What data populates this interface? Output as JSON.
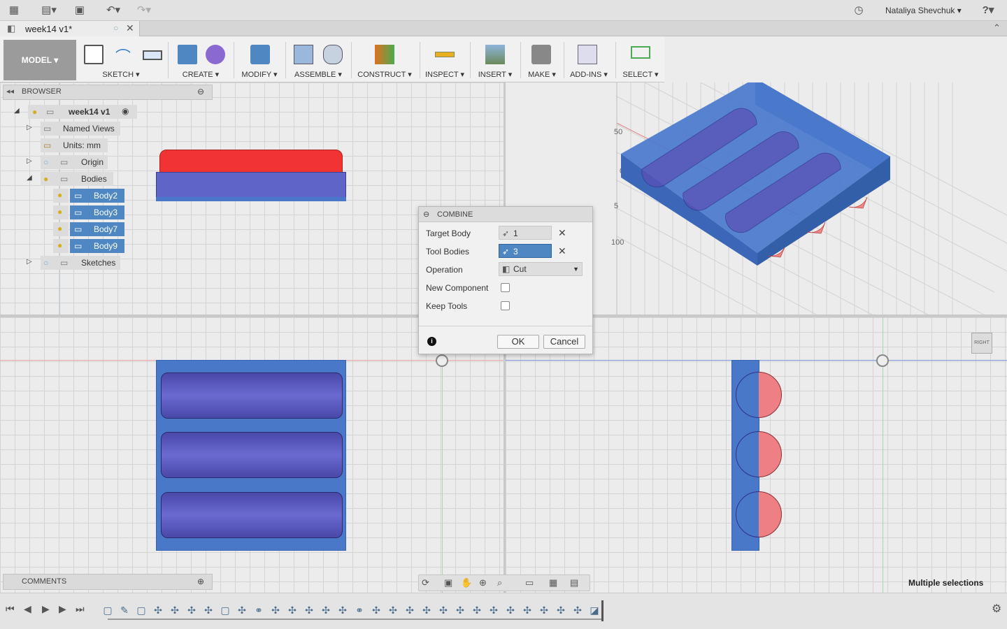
{
  "app": {
    "doc_tab_title": "week14 v1*",
    "user_name": "Nataliya Shevchuk",
    "user_caret": "▾",
    "help_icon": "?"
  },
  "toolbar": {
    "mode": "MODEL",
    "groups": [
      {
        "label": "SKETCH"
      },
      {
        "label": "CREATE"
      },
      {
        "label": "MODIFY"
      },
      {
        "label": "ASSEMBLE"
      },
      {
        "label": "CONSTRUCT"
      },
      {
        "label": "INSPECT"
      },
      {
        "label": "INSERT"
      },
      {
        "label": "MAKE"
      },
      {
        "label": "ADD-INS"
      },
      {
        "label": "SELECT"
      }
    ]
  },
  "browser": {
    "title": "BROWSER",
    "root": "week14 v1",
    "items": [
      {
        "label": "Named Views"
      },
      {
        "label": "Units: mm"
      },
      {
        "label": "Origin"
      },
      {
        "label": "Bodies"
      },
      {
        "label": "Body2"
      },
      {
        "label": "Body3"
      },
      {
        "label": "Body7"
      },
      {
        "label": "Body9"
      },
      {
        "label": "Sketches"
      }
    ]
  },
  "combine": {
    "title": "COMBINE",
    "target_body_label": "Target Body",
    "target_body_value": "1 selected",
    "tool_bodies_label": "Tool Bodies",
    "tool_bodies_value": "3 selected",
    "operation_label": "Operation",
    "operation_value": "Cut",
    "new_component_label": "New Component",
    "keep_tools_label": "Keep Tools",
    "ok_label": "OK",
    "cancel_label": "Cancel"
  },
  "comments": {
    "title": "COMMENTS"
  },
  "status": {
    "selection": "Multiple selections"
  },
  "viewcube": {
    "label": "RIGHT"
  },
  "iso_axis_labels": [
    "50",
    "0",
    "5",
    "100"
  ],
  "colors": {
    "body_blue": "#4a78c8",
    "cylinder_purple": "#5a50b8",
    "red_body": "#ee3333",
    "selection_blue": "#4f87c3"
  }
}
